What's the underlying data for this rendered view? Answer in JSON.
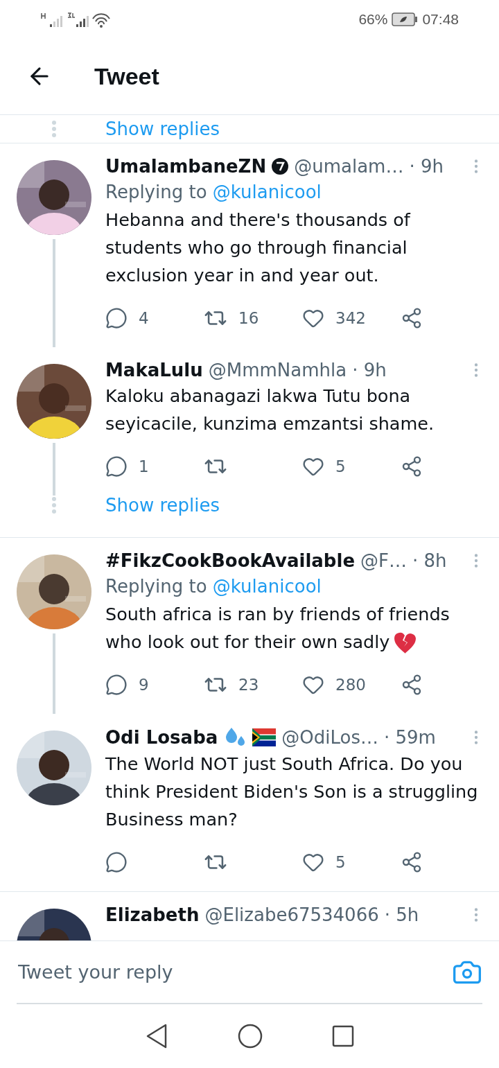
{
  "status_bar": {
    "battery": "66%",
    "time": "07:48"
  },
  "header": {
    "title": "Tweet"
  },
  "top_link": "Show replies",
  "threads": [
    {
      "tweets": [
        {
          "name": "UmalambaneZN",
          "verified": true,
          "handle": "@umalam…",
          "time": "· 9h",
          "replying_to": {
            "label": "Replying to",
            "handle": "@kulanicool"
          },
          "text": "Hebanna and there's thousands of students who go through financial exclusion year in and year out.",
          "counts": {
            "reply": "4",
            "retweet": "16",
            "like": "342"
          }
        },
        {
          "name": "MakaLulu",
          "handle": "@MmmNamhla",
          "time": "· 9h",
          "text": "Kaloku abanagazi lakwa Tutu bona seyicacile,   kunzima emzantsi shame.",
          "counts": {
            "reply": "1",
            "like": "5"
          }
        }
      ],
      "show_replies": "Show replies"
    },
    {
      "tweets": [
        {
          "name": "#FikzCookBookAvailable",
          "handle": "@F…",
          "time": "· 8h",
          "replying_to": {
            "label": "Replying to",
            "handle": "@kulanicool"
          },
          "text": "South africa is ran  by friends of friends who look out for their own sadly",
          "broken_heart": true,
          "counts": {
            "reply": "9",
            "retweet": "23",
            "like": "280"
          }
        },
        {
          "name": "Odi Losaba",
          "sweat_droplets": true,
          "flag": true,
          "handle": "@OdiLos…",
          "time": "· 59m",
          "text": "The World NOT just South Africa. Do you think President Biden's Son is a struggling Business man?",
          "counts": {
            "like": "5"
          }
        }
      ]
    },
    {
      "tweets": [
        {
          "name": "Elizabeth",
          "handle": "@Elizabe67534066",
          "time": "· 5h"
        }
      ]
    }
  ],
  "reply_field": {
    "placeholder": "Tweet your reply"
  }
}
